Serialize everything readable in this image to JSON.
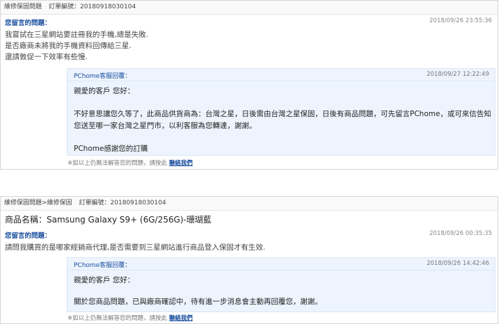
{
  "cards": [
    {
      "header_category": "維修保固問題",
      "header_order": "訂單編號：20180918030104",
      "question_label": "您留言的問題：",
      "question_date": "2018/09/26 23:55:36",
      "question_lines": [
        "我嘗試在三星網站要註冊我的手機,總是失敗.",
        "是否廠商未將我的手機資料回傳給三星.",
        "還請敦促一下效率有些慢."
      ],
      "reply_label": "PChome客服回覆：",
      "reply_date": "2018/09/27 12:22:49",
      "reply_greeting": "親愛的客戶 您好：",
      "reply_text": "不好意思讓您久等了，此商品供貨商為：台灣之星，日後需由台灣之星保固，日後有商品問題，可先留言PChome，或可來信告知您送至哪一家台灣之星門市，以利客服為您轉達，謝謝。",
      "reply_thanks": "PChome感謝您的訂購",
      "footnote_text": "※如以上仍無法解答您的問題，請按此",
      "footnote_link": "聯絡我們"
    },
    {
      "header_category": "維修保固問題>維修保固",
      "header_order": "訂單編號：20180918030104",
      "product": "商品名稱：Samsung Galaxy S9+ (6G/256G)-珊瑚藍",
      "question_label": "您留言的問題：",
      "question_date": "2018/09/26 00:35:35",
      "question_lines": [
        "請問我購買的是哪家經銷商代理,是否需要到三星網站進行商品登入保固才有生效."
      ],
      "reply_label": "PChome客服回覆：",
      "reply_date": "2018/09/26 14:42:46",
      "reply_greeting": "親愛的客戶 您好：",
      "reply_text": "關於您商品問題，已與廠商確認中，待有進一步消息會主動再回覆您，謝謝。",
      "footnote_text": "※如以上仍無法解答您的問題，請按此",
      "footnote_link": "聯絡我們"
    }
  ],
  "colors": {
    "link": "#1a4fa0",
    "reply_bg": "#edf4fd",
    "border": "#d6d6d6"
  }
}
